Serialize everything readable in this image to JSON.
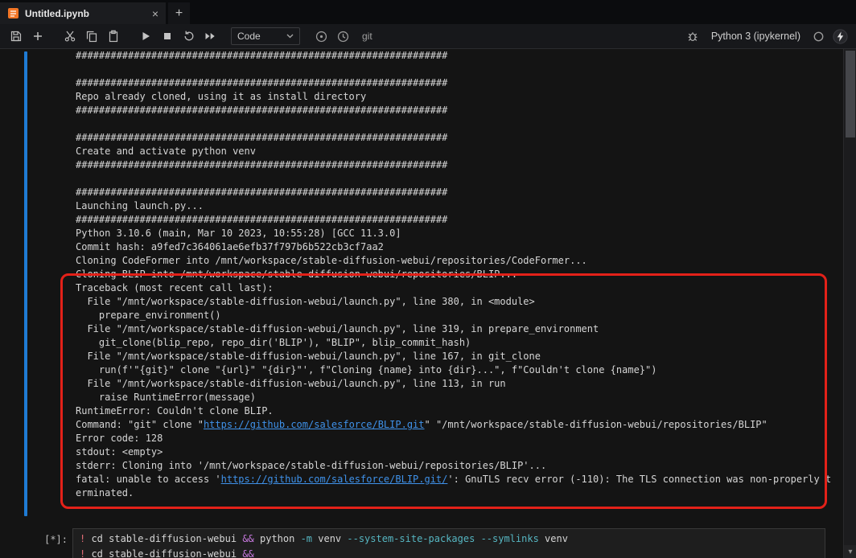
{
  "tabbar": {
    "tab_title": "Untitled.ipynb",
    "close_label": "×",
    "new_tab_label": "+"
  },
  "toolbar": {
    "cell_type": "Code",
    "git_label": "git",
    "kernel_name": "Python 3 (ipykernel)",
    "icons": [
      "save-icon",
      "add-cell-icon",
      "cut-cell-icon",
      "copy-cell-icon",
      "paste-cell-icon",
      "run-icon",
      "stop-icon",
      "restart-kernel-icon",
      "run-all-icon",
      "chevron-down-icon",
      "globe-icon",
      "history-icon",
      "debugger-bug-icon",
      "kernel-status-icon",
      "bolt-icon"
    ]
  },
  "output": {
    "lines": [
      "################################################################",
      "",
      "################################################################",
      "Repo already cloned, using it as install directory",
      "################################################################",
      "",
      "################################################################",
      "Create and activate python venv",
      "################################################################",
      "",
      "################################################################",
      "Launching launch.py...",
      "################################################################",
      "Python 3.10.6 (main, Mar 10 2023, 10:55:28) [GCC 11.3.0]",
      "Commit hash: a9fed7c364061ae6efb37f797b6b522cb3cf7aa2",
      "Cloning CodeFormer into /mnt/workspace/stable-diffusion-webui/repositories/CodeFormer...",
      "Cloning BLIP into /mnt/workspace/stable-diffusion-webui/repositories/BLIP...",
      "Traceback (most recent call last):",
      "  File \"/mnt/workspace/stable-diffusion-webui/launch.py\", line 380, in <module>",
      "    prepare_environment()",
      "  File \"/mnt/workspace/stable-diffusion-webui/launch.py\", line 319, in prepare_environment",
      "    git_clone(blip_repo, repo_dir('BLIP'), \"BLIP\", blip_commit_hash)",
      "  File \"/mnt/workspace/stable-diffusion-webui/launch.py\", line 167, in git_clone",
      "    run(f'\"{git}\" clone \"{url}\" \"{dir}\"', f\"Cloning {name} into {dir}...\", f\"Couldn't clone {name}\")",
      "  File \"/mnt/workspace/stable-diffusion-webui/launch.py\", line 113, in run",
      "    raise RuntimeError(message)",
      "RuntimeError: Couldn't clone BLIP.",
      [
        {
          "t": "Command: \"git\" clone \"",
          "s": "plain"
        },
        {
          "t": "https://github.com/salesforce/BLIP.git",
          "s": "link"
        },
        {
          "t": "\" \"/mnt/workspace/stable-diffusion-webui/repositories/BLIP\"",
          "s": "plain"
        }
      ],
      "Error code: 128",
      "stdout: <empty>",
      "stderr: Cloning into '/mnt/workspace/stable-diffusion-webui/repositories/BLIP'...",
      [
        {
          "t": "fatal: unable to access '",
          "s": "plain"
        },
        {
          "t": "https://github.com/salesforce/BLIP.git/",
          "s": "link"
        },
        {
          "t": "': GnuTLS recv error (-110): The TLS connection was non-properly t",
          "s": "plain"
        }
      ],
      "erminated."
    ]
  },
  "cell": {
    "prompt": "[*]:",
    "lines": [
      [
        {
          "t": "!",
          "s": "bang"
        },
        {
          "t": " cd stable-diffusion-webui ",
          "s": "plain"
        },
        {
          "t": "&&",
          "s": "op"
        },
        {
          "t": " python ",
          "s": "plain"
        },
        {
          "t": "-m",
          "s": "flag"
        },
        {
          "t": " venv ",
          "s": "plain"
        },
        {
          "t": "--system-site-packages",
          "s": "flag"
        },
        {
          "t": " ",
          "s": "plain"
        },
        {
          "t": "--symlinks",
          "s": "flag"
        },
        {
          "t": " venv",
          "s": "plain"
        }
      ],
      [
        {
          "t": "!",
          "s": "bang"
        },
        {
          "t": " cd stable-diffusion-webui ",
          "s": "plain"
        },
        {
          "t": "&&",
          "s": "op"
        },
        {
          "t": " ",
          "s": "plain"
        }
      ]
    ]
  },
  "scrollbar": {
    "down_arrow": "▾"
  },
  "colors": {
    "accent_blue": "#1f7bd4",
    "link_blue": "#3f92ea",
    "error_red": "#e32119",
    "operator_purple": "#c678dd",
    "flag_cyan": "#56b6c2",
    "bang_red": "#e06c75",
    "notebook_orange": "#f37626"
  }
}
